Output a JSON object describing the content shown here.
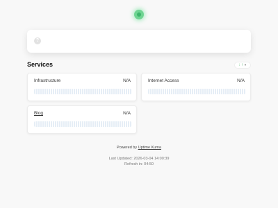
{
  "status": {
    "state": "up",
    "color": "#5cdd8b"
  },
  "description": {
    "help_icon": "question-circle-icon"
  },
  "services": {
    "title": "Services",
    "sort_control": {
      "icon": "sort-icon",
      "arrow_color": "#4aa864"
    },
    "monitors": [
      {
        "name": "Infrastructure",
        "uptime": "N/A"
      },
      {
        "name": "Internet Access",
        "uptime": "N/A"
      },
      {
        "name": "Blog",
        "uptime": "N/A"
      }
    ]
  },
  "footer": {
    "powered_prefix": "Powered by",
    "powered_link": "Uptime Kuma",
    "last_updated": "Last Updated: 2026-03-04 14:00:39",
    "refresh": "Refresh in: 04:50"
  }
}
